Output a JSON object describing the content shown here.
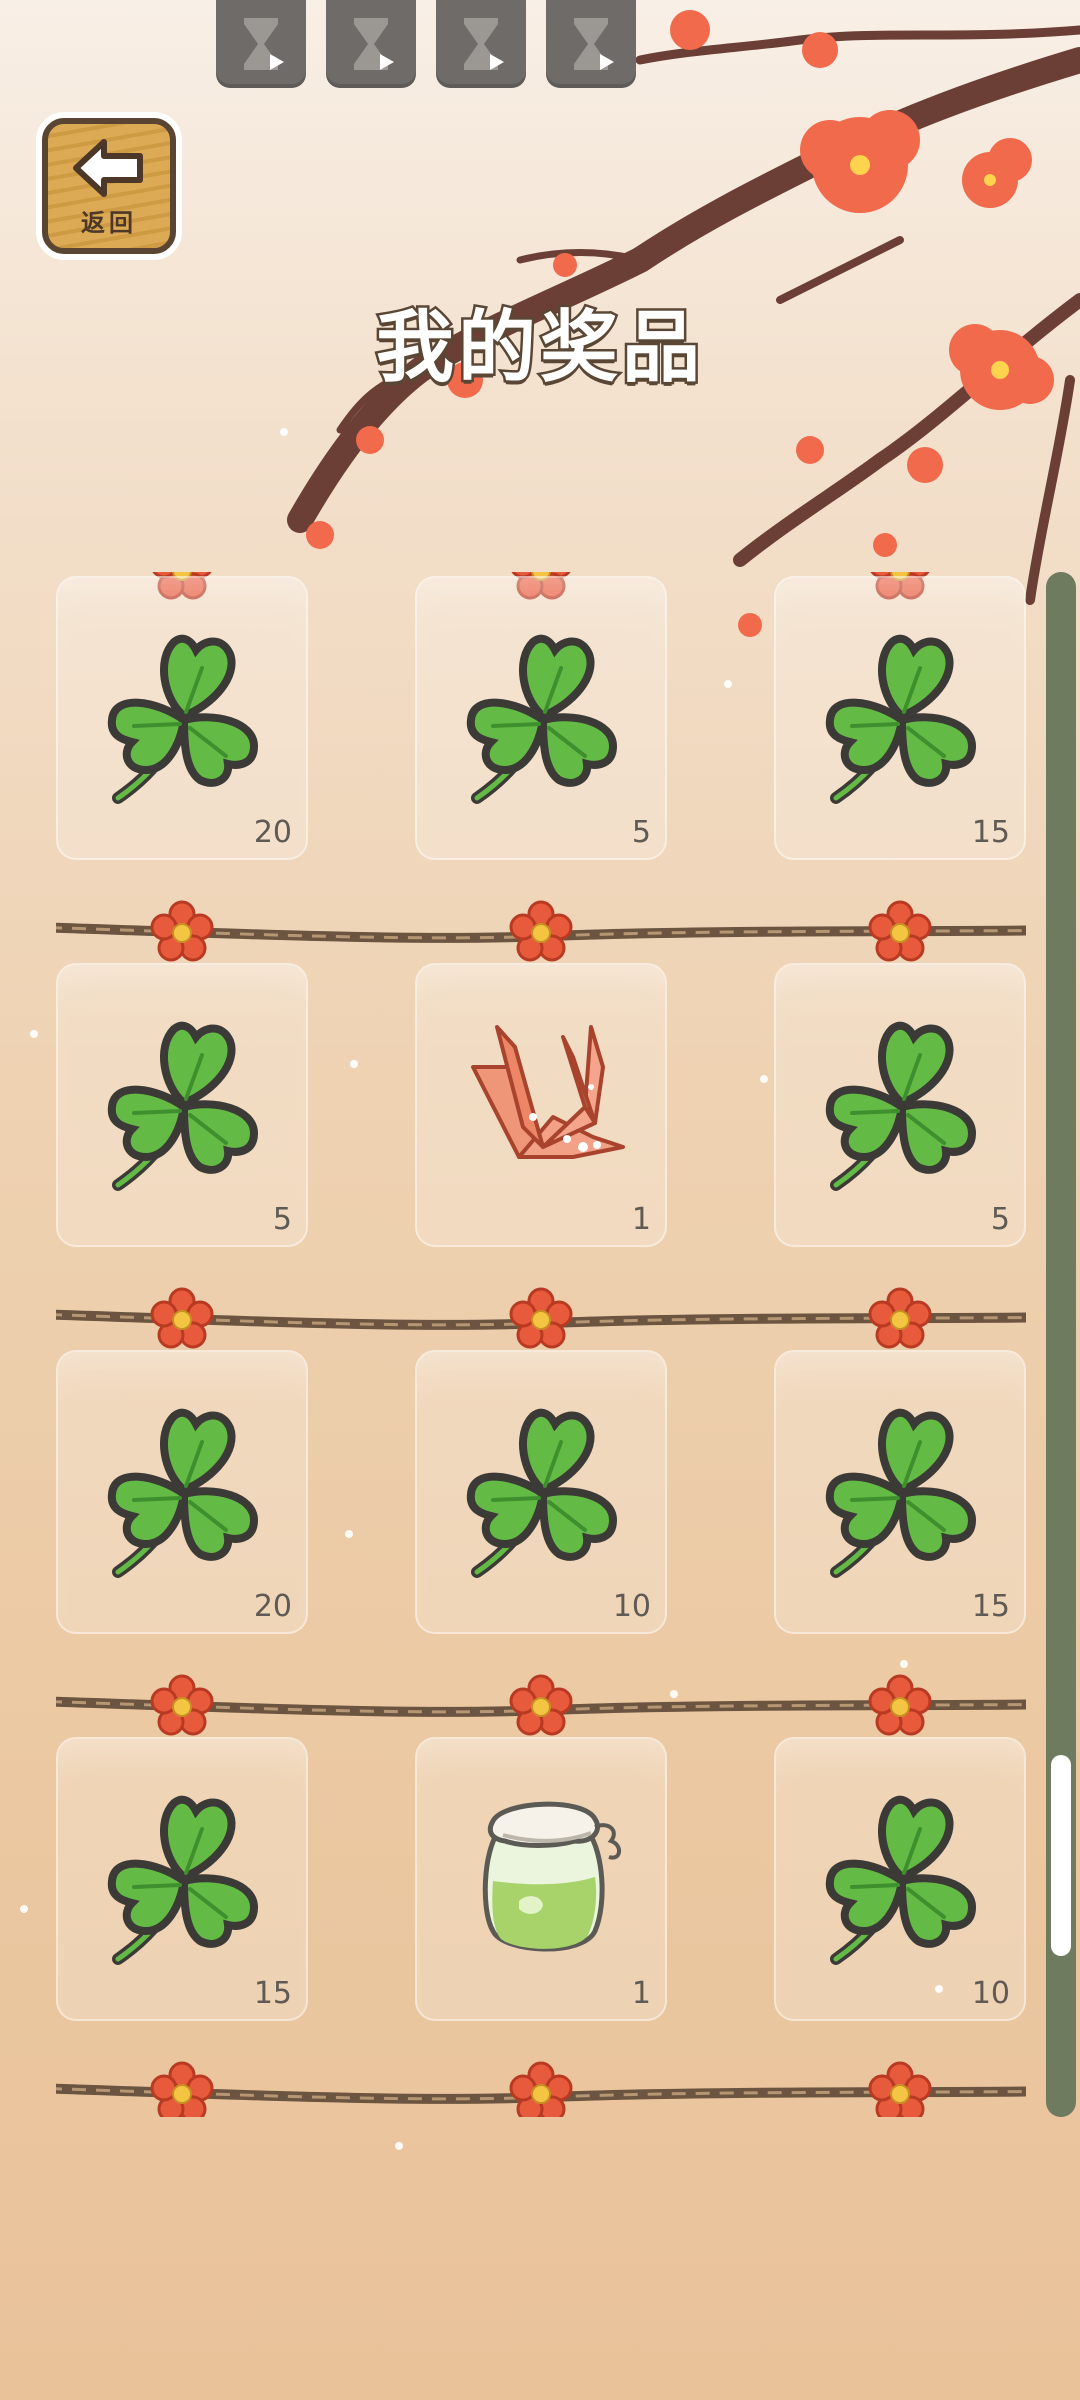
{
  "header": {
    "title": "我的奖品",
    "back_label": "返回",
    "hourglass_buttons": [
      "hourglass-icon",
      "hourglass-icon",
      "hourglass-icon",
      "hourglass-icon"
    ]
  },
  "colors": {
    "clover": "#63bb45",
    "card_bg": "rgba(255,255,255,0.22)",
    "rope": "#6b5440",
    "flower": "#e85a3c",
    "scroll_track": "#6e7b5f"
  },
  "prizes": [
    {
      "icon": "clover-icon",
      "count": "20"
    },
    {
      "icon": "clover-icon",
      "count": "5"
    },
    {
      "icon": "clover-icon",
      "count": "15"
    },
    {
      "icon": "clover-icon",
      "count": "5"
    },
    {
      "icon": "paper-crane-icon",
      "count": "1"
    },
    {
      "icon": "clover-icon",
      "count": "5"
    },
    {
      "icon": "clover-icon",
      "count": "20"
    },
    {
      "icon": "clover-icon",
      "count": "10"
    },
    {
      "icon": "clover-icon",
      "count": "15"
    },
    {
      "icon": "clover-icon",
      "count": "15"
    },
    {
      "icon": "jar-icon",
      "count": "1"
    },
    {
      "icon": "clover-icon",
      "count": "10"
    }
  ],
  "scroll": {
    "position_fraction": 0.88,
    "visible_fraction": 0.13
  }
}
